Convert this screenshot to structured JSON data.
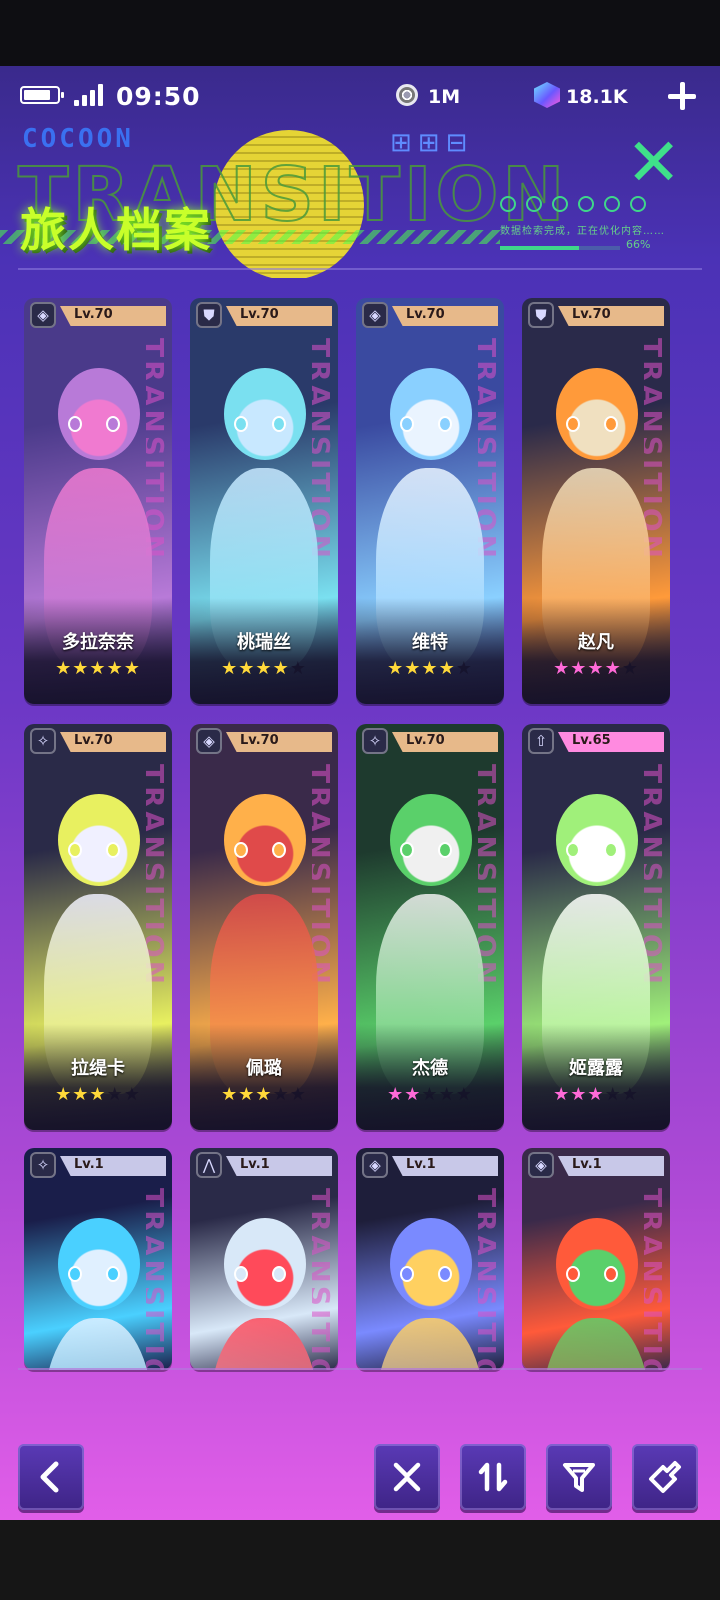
{
  "status_bar": {
    "time": "09:50",
    "battery_level": 0.8
  },
  "currency": {
    "coin_value": "1M",
    "gem_value": "18.1K"
  },
  "header": {
    "title": "旅人档案",
    "decor_brand": "COCOON",
    "decor_word": "TRANSITION",
    "decor_status": "数据检索完成，正在优化内容……",
    "decor_progress_label": "66%",
    "decor_progress": 0.66
  },
  "characters": [
    {
      "name": "多拉奈奈",
      "level": "Lv.70",
      "stars": 5,
      "star_color": "#ffd93a",
      "tab_color": "#e7b98a",
      "class_icon": "◈",
      "palette": [
        "#4a3a8a",
        "#b87ad8",
        "#f07ad0"
      ]
    },
    {
      "name": "桃瑞丝",
      "level": "Lv.70",
      "stars": 4,
      "star_color": "#ffd93a",
      "tab_color": "#e7b98a",
      "class_icon": "⛊",
      "palette": [
        "#2a3a6a",
        "#7ae0f0",
        "#c8e8ff"
      ]
    },
    {
      "name": "维特",
      "level": "Lv.70",
      "stars": 4,
      "star_color": "#ffd93a",
      "tab_color": "#e7b98a",
      "class_icon": "◈",
      "palette": [
        "#3a4aa0",
        "#8ad0ff",
        "#eaf4ff"
      ]
    },
    {
      "name": "赵凡",
      "level": "Lv.70",
      "stars": 4,
      "star_color": "#ff6ad8",
      "tab_color": "#e7b98a",
      "class_icon": "⛊",
      "palette": [
        "#2a2a4a",
        "#ff9a3a",
        "#f0e0c0"
      ]
    },
    {
      "name": "拉缇卡",
      "level": "Lv.70",
      "stars": 3,
      "star_color": "#ffd93a",
      "tab_color": "#e7b98a",
      "class_icon": "✧",
      "palette": [
        "#2a2a48",
        "#e8f060",
        "#f0f0ff"
      ]
    },
    {
      "name": "佩璐",
      "level": "Lv.70",
      "stars": 3,
      "star_color": "#ffd93a",
      "tab_color": "#e7b98a",
      "class_icon": "◈",
      "palette": [
        "#3a2a4a",
        "#ffb04a",
        "#e04a4a"
      ]
    },
    {
      "name": "杰德",
      "level": "Lv.70",
      "stars": 2,
      "star_color": "#ff6ad8",
      "tab_color": "#e7b98a",
      "class_icon": "✧",
      "palette": [
        "#1e3a2e",
        "#5ad06a",
        "#f0f0f0"
      ]
    },
    {
      "name": "姬露露",
      "level": "Lv.65",
      "stars": 3,
      "star_color": "#ff6ad8",
      "tab_color": "#ff8ae0",
      "class_icon": "⇧",
      "palette": [
        "#2a2a48",
        "#a0f07a",
        "#ffffff"
      ]
    },
    {
      "name": "",
      "level": "Lv.1",
      "stars": 0,
      "star_color": "#ffd93a",
      "tab_color": "#c8c8e8",
      "class_icon": "✧",
      "palette": [
        "#1a1e4a",
        "#4ad0ff",
        "#e0f0ff"
      ]
    },
    {
      "name": "",
      "level": "Lv.1",
      "stars": 0,
      "star_color": "#ffd93a",
      "tab_color": "#c8c8e8",
      "class_icon": "⋀",
      "palette": [
        "#2a2a48",
        "#d8e8f8",
        "#ff4a5a"
      ]
    },
    {
      "name": "",
      "level": "Lv.1",
      "stars": 0,
      "star_color": "#ffd93a",
      "tab_color": "#c8c8e8",
      "class_icon": "◈",
      "palette": [
        "#1e1e3a",
        "#7a8aff",
        "#ffd060"
      ]
    },
    {
      "name": "",
      "level": "Lv.1",
      "stars": 0,
      "star_color": "#ffd93a",
      "tab_color": "#c8c8e8",
      "class_icon": "◈",
      "palette": [
        "#3a2a4a",
        "#ff5a3a",
        "#5ad06a"
      ]
    }
  ],
  "footer": {
    "back_icon": "chevron-left-icon",
    "tools": [
      "close-x-icon",
      "sort-icon",
      "filter-icon",
      "favorite-tag-icon"
    ]
  },
  "colors": {
    "title_green": "#c8ff2a",
    "accent_purple": "#5a3ab6"
  }
}
